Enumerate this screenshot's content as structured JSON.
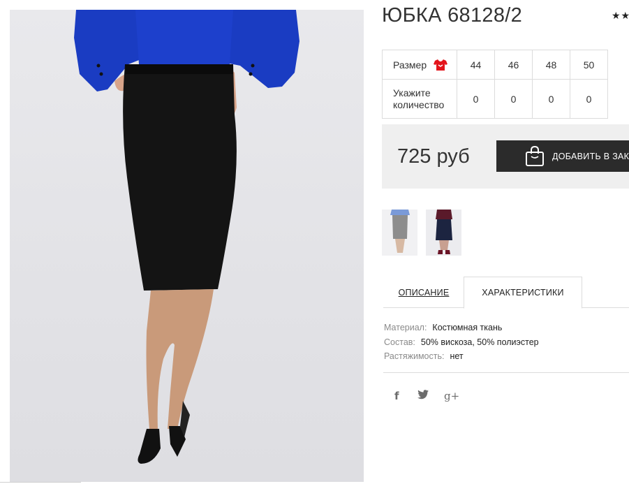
{
  "product": {
    "title": "ЮБКА 68128/2",
    "stars": "★★"
  },
  "size_table": {
    "size_label": "Размер",
    "qty_label_line1": "Укажите",
    "qty_label_line2": "количество",
    "sizes": [
      "44",
      "46",
      "48",
      "50"
    ],
    "quantities": [
      "0",
      "0",
      "0",
      "0"
    ]
  },
  "purchase": {
    "price": "725 руб",
    "add_to_cart_label": "ДОБАВИТЬ В ЗАКАЗ"
  },
  "tabs": {
    "description": "ОПИСАНИЕ",
    "characteristics": "ХАРАКТЕРИСТИКИ"
  },
  "specs": [
    {
      "key": "Материал:",
      "value": "Костюмная ткань"
    },
    {
      "key": "Состав:",
      "value": "50% вискоза, 50% полиэстер"
    },
    {
      "key": "Растяжимость:",
      "value": "нет"
    }
  ],
  "social": {
    "facebook": "f",
    "twitter": "🐦",
    "google_plus": "g+"
  },
  "colors": {
    "button_bg": "#2b2b2b",
    "price_box_bg": "#efefef",
    "size_icon": "#e3141b"
  },
  "icons": [
    "size-chart-icon",
    "shopping-bag-icon",
    "facebook-icon",
    "twitter-icon",
    "google-plus-icon"
  ]
}
